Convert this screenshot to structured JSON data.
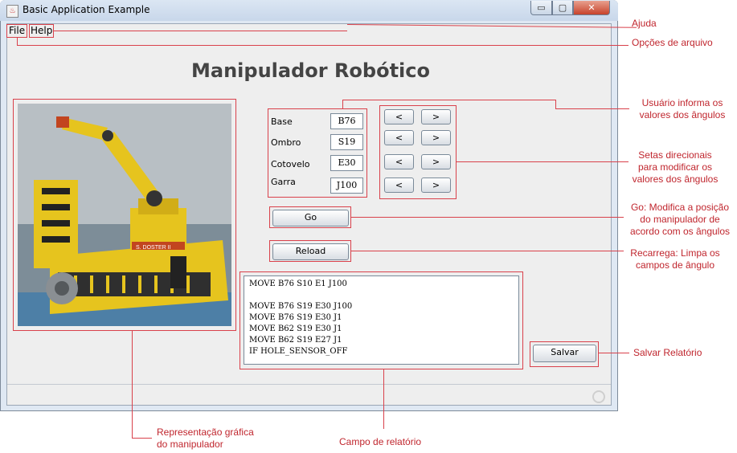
{
  "window": {
    "title": "Basic Application Example",
    "app_icon": "java-icon",
    "controls": {
      "minimize": "▭",
      "maximize": "▢",
      "close": "✕"
    }
  },
  "menu": {
    "file": "File",
    "help": "Help"
  },
  "app_title": "Manipulador Robótico",
  "angles": [
    {
      "label": "Base",
      "value": "B76"
    },
    {
      "label": "Ombro",
      "value": "S19"
    },
    {
      "label": "Cotovelo",
      "value": "E30"
    },
    {
      "label": "Garra",
      "value": "J100"
    }
  ],
  "arrows": {
    "left": "<",
    "right": ">"
  },
  "buttons": {
    "go": "Go",
    "reload": "Reload",
    "save": "Salvar"
  },
  "report_lines": [
    "MOVE B76 S10 E1 J100",
    "",
    "MOVE B76 S19 E30 J100",
    "MOVE B76 S19 E30 J1",
    "MOVE B62 S19 E30 J1",
    "MOVE B62 S19 E27 J1",
    "IF HOLE_SENSOR_OFF"
  ],
  "photo": {
    "label": "S. DOSTER II"
  },
  "callouts": {
    "ajuda": "Ajuda",
    "opcoes": "Opções de arquivo",
    "usuario": [
      "Usuário informa os",
      "valores dos ângulos"
    ],
    "setas": [
      "Setas direcionais",
      "para modificar os",
      "valores dos ângulos"
    ],
    "go": [
      "Go: Modifica a posição",
      "do manipulador de",
      "acordo com os ângulos"
    ],
    "recarrega": [
      "Recarrega: Limpa os",
      "campos de ângulo"
    ],
    "salvar": "Salvar Relatório",
    "representacao": [
      "Representação gráfica",
      "do manipulador"
    ],
    "campo": "Campo de relatório"
  },
  "colors": {
    "annotation": "#d9414b",
    "title": "#444444"
  }
}
